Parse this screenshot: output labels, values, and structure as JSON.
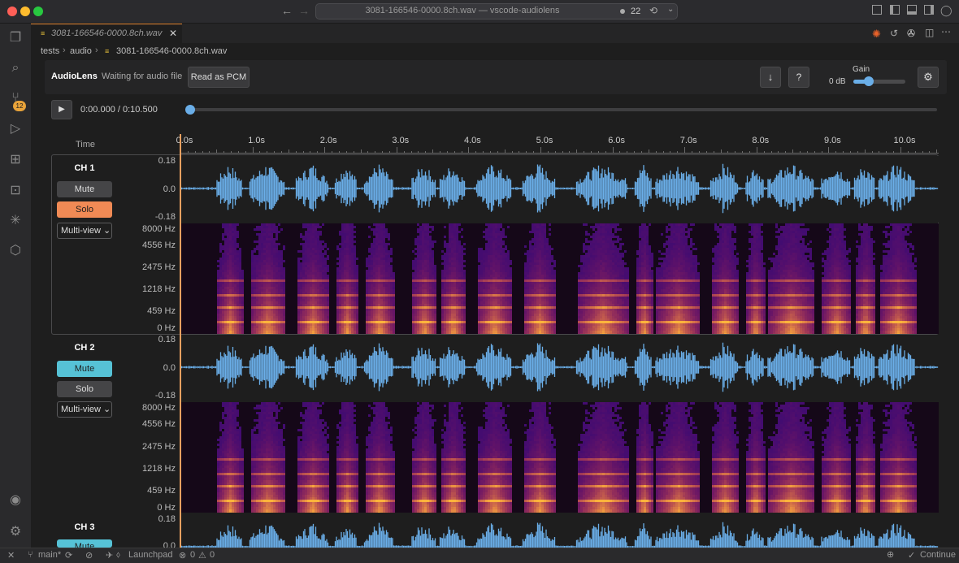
{
  "window": {
    "title": "3081-166546-0000.8ch.wav — vscode-audiolens",
    "notification_count": "22"
  },
  "colors": {
    "accent": "#e88b3a",
    "waveform": "#6aaee8",
    "mute_active": "#56c2d6",
    "solo_active": "#f08a55",
    "playhead": "#e8a060"
  },
  "activity_bar": {
    "scm_badge": "12",
    "icons": [
      "explorer-icon",
      "search-icon",
      "source-control-icon",
      "run-debug-icon",
      "extensions-icon",
      "remote-icon",
      "claude-icon",
      "packages-icon",
      "account-icon",
      "settings-icon"
    ]
  },
  "tab": {
    "label": "3081-166546-0000.8ch.wav"
  },
  "breadcrumbs": [
    "tests",
    "audio",
    "3081-166546-0000.8ch.wav"
  ],
  "toolbar": {
    "app_name": "AudioLens",
    "status": "Waiting for audio file",
    "read_pcm_label": "Read as PCM",
    "download_label": "↓",
    "help_label": "?",
    "gain_label": "Gain",
    "gain_value": "0 dB",
    "gain_level": 0.3,
    "settings_label": "⚙"
  },
  "transport": {
    "time": "0:00.000 / 0:10.500",
    "play_label": "▶",
    "progress": 0.0
  },
  "timeline": {
    "header": "Time",
    "ticks": [
      "0.0s",
      "1.0s",
      "2.0s",
      "3.0s",
      "4.0s",
      "5.0s",
      "6.0s",
      "7.0s",
      "8.0s",
      "9.0s",
      "10.0s"
    ]
  },
  "waveform_axis": [
    "0.18",
    "0.0",
    "-0.18"
  ],
  "spectrogram_axis": [
    "8000 Hz",
    "4556 Hz",
    "2475 Hz",
    "1218 Hz",
    "459 Hz",
    "0 Hz"
  ],
  "channels": [
    {
      "name": "CH 1",
      "mute": "Mute",
      "solo": "Solo",
      "view": "Multi-view",
      "muted": false,
      "soloed": true
    },
    {
      "name": "CH 2",
      "mute": "Mute",
      "solo": "Solo",
      "view": "Multi-view",
      "muted": true,
      "soloed": false
    },
    {
      "name": "CH 3",
      "mute": "Mute",
      "muted": true
    }
  ],
  "statusbar": {
    "branch": "main*",
    "launchpad": "Launchpad",
    "errors": "0",
    "warnings": "0",
    "continue": "Continue"
  }
}
